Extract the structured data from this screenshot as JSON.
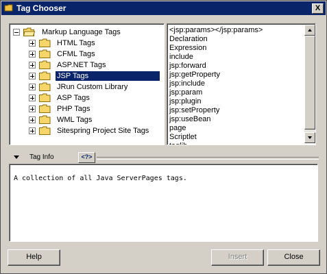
{
  "window": {
    "title": "Tag Chooser",
    "close_label": "X"
  },
  "tree": {
    "root": "Markup Language Tags",
    "items": [
      "HTML Tags",
      "CFML Tags",
      "ASP.NET Tags",
      "JSP Tags",
      "JRun Custom Library",
      "ASP Tags",
      "PHP Tags",
      "WML Tags",
      "Sitespring Project Site Tags"
    ],
    "selected": "JSP Tags"
  },
  "taglist": {
    "items": [
      "<jsp:params></jsp:params>",
      "Declaration",
      "Expression",
      "include",
      "jsp:forward",
      "jsp:getProperty",
      "jsp:include",
      "jsp:param",
      "jsp:plugin",
      "jsp:setProperty",
      "jsp:useBean",
      "page",
      "Scriptlet",
      "taglib"
    ]
  },
  "taginfo": {
    "label": "Tag Info",
    "help_glyph": "?",
    "description": "A collection of all Java ServerPages tags."
  },
  "buttons": {
    "help": "Help",
    "insert": "Insert",
    "close": "Close"
  },
  "colors": {
    "titlebar": "#0a246a",
    "dialog_bg": "#d4d0c8",
    "selection": "#0a246a"
  }
}
